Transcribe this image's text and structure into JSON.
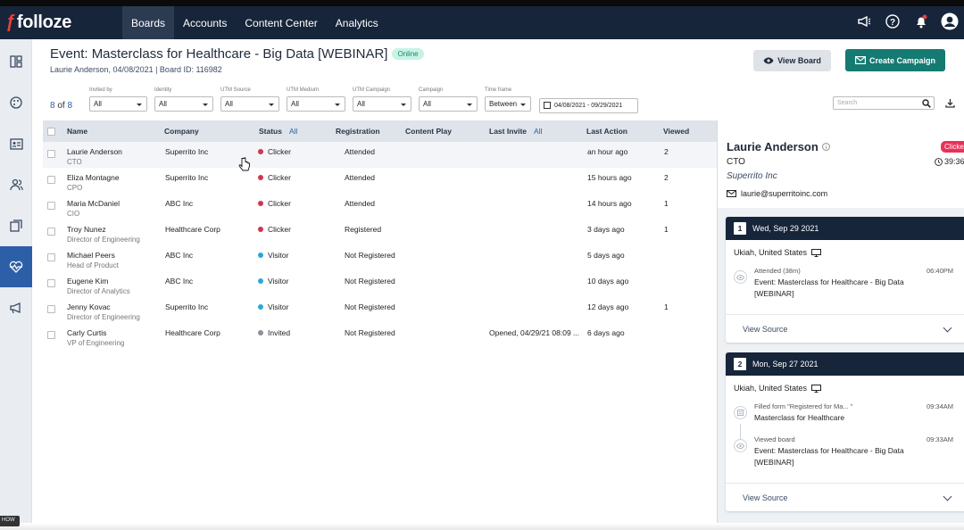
{
  "app": {
    "logo": "folloze"
  },
  "nav": [
    "Boards",
    "Accounts",
    "Content Center",
    "Analytics"
  ],
  "topicons": [
    "megaphone-icon",
    "help-icon",
    "bell-icon",
    "user-icon"
  ],
  "sidebar": [
    "dashboard-icon",
    "palette-icon",
    "contact-card-icon",
    "people-icon",
    "boards-icon",
    "heartbeat-icon",
    "campaign-icon"
  ],
  "header": {
    "title": "Event: Masterclass for Healthcare - Big Data [WEBINAR]",
    "badge": "Online",
    "subtitle": "Laurie Anderson, 04/08/2021 | Board ID: 116982",
    "view_board": "View Board",
    "create_campaign": "Create Campaign"
  },
  "filters": {
    "count_shown": "8",
    "count_of": "of",
    "count_total": "8",
    "items": [
      {
        "label": "Invited by",
        "value": "All"
      },
      {
        "label": "Identity",
        "value": "All"
      },
      {
        "label": "UTM Source",
        "value": "All"
      },
      {
        "label": "UTM Medium",
        "value": "All"
      },
      {
        "label": "UTM Campaign",
        "value": "All"
      },
      {
        "label": "Campaign",
        "value": "All"
      },
      {
        "label": "Time frame",
        "value": "Between"
      }
    ],
    "date_range": "04/08/2021 - 09/29/2021",
    "search_placeholder": "Search"
  },
  "table": {
    "headers": {
      "name": "Name",
      "company": "Company",
      "status": "Status",
      "status_filter": "All",
      "registration": "Registration",
      "content_play": "Content Play",
      "last_invite": "Last Invite",
      "last_invite_filter": "All",
      "last_action": "Last Action",
      "viewed": "Viewed"
    },
    "rows": [
      {
        "name": "Laurie Anderson",
        "title": "CTO",
        "company": "Superrito Inc",
        "status": "Clicker",
        "status_color": "#d2354c",
        "registration": "Attended",
        "last_invite": "",
        "last_action": "an hour ago",
        "viewed": "2"
      },
      {
        "name": "Eliza Montagne",
        "title": "CPO",
        "company": "Superrito Inc",
        "status": "Clicker",
        "status_color": "#d2354c",
        "registration": "Attended",
        "last_invite": "",
        "last_action": "15 hours ago",
        "viewed": "2"
      },
      {
        "name": "Maria McDaniel",
        "title": "CIO",
        "company": "ABC Inc",
        "status": "Clicker",
        "status_color": "#d2354c",
        "registration": "Attended",
        "last_invite": "",
        "last_action": "14 hours ago",
        "viewed": "1"
      },
      {
        "name": "Troy Nunez",
        "title": "Director of Engineering",
        "company": "Healthcare Corp",
        "status": "Clicker",
        "status_color": "#d2354c",
        "registration": "Registered",
        "last_invite": "",
        "last_action": "3 days ago",
        "viewed": "1"
      },
      {
        "name": "Michael Peers",
        "title": "Head of Product",
        "company": "ABC Inc",
        "status": "Visitor",
        "status_color": "#2aa7dc",
        "registration": "Not Registered",
        "last_invite": "",
        "last_action": "5 days ago",
        "viewed": ""
      },
      {
        "name": "Eugene Kim",
        "title": "Director of Analytics",
        "company": "ABC Inc",
        "status": "Visitor",
        "status_color": "#2aa7dc",
        "registration": "Not Registered",
        "last_invite": "",
        "last_action": "10 days ago",
        "viewed": ""
      },
      {
        "name": "Jenny Kovac",
        "title": "Director of Engineering",
        "company": "Superrito Inc",
        "status": "Visitor",
        "status_color": "#2aa7dc",
        "registration": "Not Registered",
        "last_invite": "",
        "last_action": "12 days ago",
        "viewed": "1"
      },
      {
        "name": "Carly Curtis",
        "title": "VP of Engineering",
        "company": "Healthcare Corp",
        "status": "Invited",
        "status_color": "#8a8f98",
        "registration": "Not Registered",
        "last_invite": "Opened, 04/29/21 08:09 ...",
        "last_action": "6 days ago",
        "viewed": ""
      }
    ]
  },
  "panel": {
    "name": "Laurie Anderson",
    "role": "CTO",
    "company": "Superrito Inc",
    "email": "laurie@superritoinc.com",
    "tag": "Clicker",
    "time": "39:36",
    "cards": [
      {
        "num": "1",
        "date": "Wed, Sep 29 2021",
        "location": "Ukiah, United States",
        "events": [
          {
            "label": "Attended (38m)",
            "text": "Event: Masterclass for Healthcare - Big Data [WEBINAR]",
            "time": "06:40PM",
            "icon": "eye-icon"
          }
        ],
        "footer": "View Source"
      },
      {
        "num": "2",
        "date": "Mon, Sep 27 2021",
        "location": "Ukiah, United States",
        "events": [
          {
            "label": "Filled form \"Registered for Ma... \"",
            "text": "Masterclass for Healthcare",
            "time": "09:34AM",
            "icon": "form-icon"
          },
          {
            "label": "Viewed board",
            "text": "Event: Masterclass for Healthcare - Big Data [WEBINAR]",
            "time": "09:33AM",
            "icon": "eye-icon"
          }
        ],
        "footer": "View Source"
      }
    ]
  },
  "hotspot": "HOW"
}
